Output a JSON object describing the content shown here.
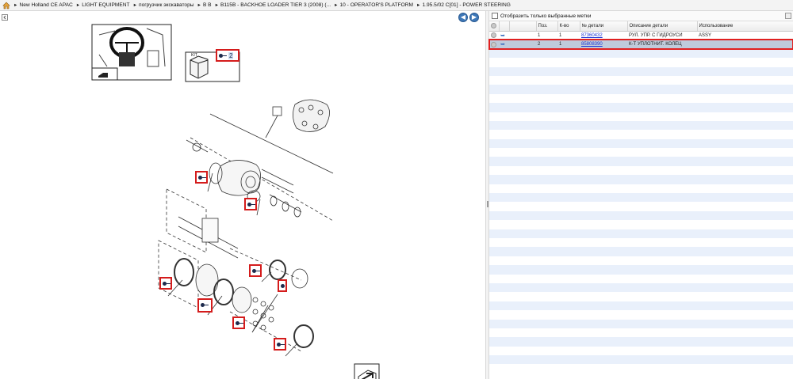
{
  "breadcrumb": {
    "home_icon": "home-icon",
    "items": [
      "New Holland CE APAC",
      "LIGHT EQUIPMENT",
      "погрузчик экскаваторы",
      "B B",
      "B115B - BACKHOE LOADER TIER 3 (2008) (...",
      "10 - OPERATOR'S PLATFORM",
      "1.95.5/02  C[01] - POWER STEERING"
    ]
  },
  "diagram": {
    "kit_label": "KIT",
    "kit_callout": "2"
  },
  "right_panel": {
    "filter_label": "Отобразить только выбранные метки",
    "filter_checked": false,
    "columns": [
      "Поз.",
      "К-во",
      "№ детали",
      "Описание детали",
      "Использование"
    ],
    "rows": [
      {
        "pos": "1",
        "qty": "1",
        "part_no": "87360432",
        "description": "РУЛ. УПР. С ГИДРОУСИ",
        "usage": "ASSY",
        "selected": false
      },
      {
        "pos": "2",
        "qty": "1",
        "part_no": "85808390",
        "description": "К-Т УПЛОТНИТ. КОЛЕЦ",
        "usage": "",
        "selected": true
      }
    ]
  },
  "colors": {
    "accent": "#3e78b8",
    "callout_border": "#d41c1c",
    "selected_row": "#bfcbdb",
    "alt_row": "#e9f0fb",
    "link": "#1a34d6"
  }
}
